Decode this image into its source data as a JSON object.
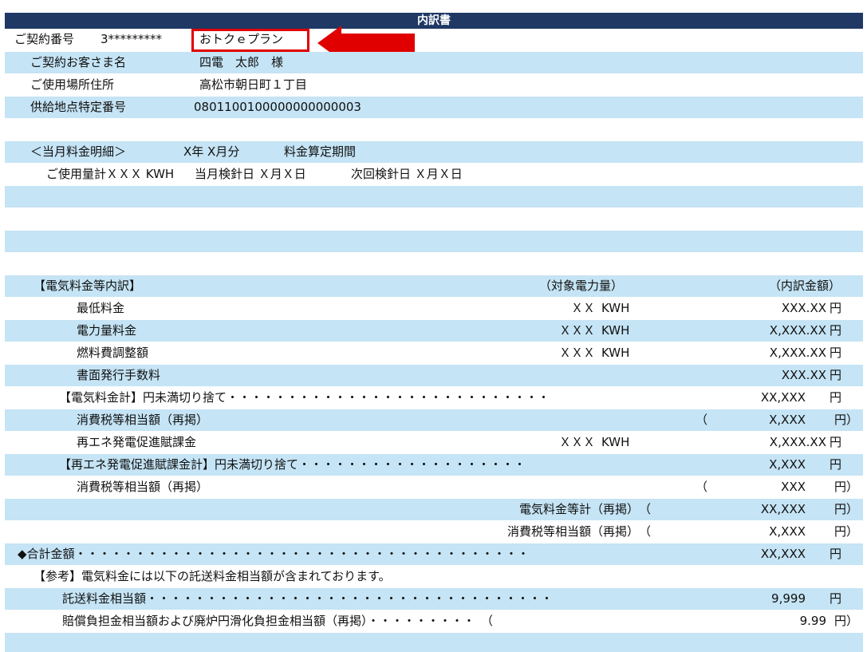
{
  "title": "内訳書",
  "contract": {
    "number_label": "ご契約番号",
    "number_value": "3*********",
    "plan": "おトクｅプラン",
    "customer_label": "ご契約お客さま名",
    "customer_value": "四電　太郎　様",
    "address_label": "ご使用場所住所",
    "address_value": "高松市朝日町１丁目",
    "supply_label": "供給地点特定番号",
    "supply_value": "0801100100000000000003"
  },
  "period": {
    "heading": "＜当月料金明細＞",
    "month": "X年 X月分",
    "calc_label": "料金算定期間",
    "usage": "ご使用量計ＸＸＸ KWH",
    "this_meter": "当月検針日 Ｘ月Ｘ日",
    "next_meter": "次回検針日 Ｘ月Ｘ日"
  },
  "breakdown": {
    "heading": "【電気料金等内訳】",
    "col_power": "（対象電力量）",
    "col_amount": "（内訳金額）",
    "rows": [
      {
        "label": "最低料金",
        "qty": "ＸＸ",
        "unit": "KWH",
        "amount": "XXX.XX",
        "yen": "円"
      },
      {
        "label": "電力量料金",
        "qty": "ＸＸＸ",
        "unit": "KWH",
        "amount": "X,XXX.XX",
        "yen": "円"
      },
      {
        "label": "燃料費調整額",
        "qty": "ＸＸＸ",
        "unit": "KWH",
        "amount": "X,XXX.XX",
        "yen": "円"
      },
      {
        "label": "書面発行手数料",
        "qty": "",
        "unit": "",
        "amount": "XXX.XX",
        "yen": "円"
      }
    ],
    "elec_total_label": "【電気料金計】円未満切り捨て・・・・・・・・・・・・・・・・・・・・・・・・・・・",
    "elec_total_amount": "XX,XXX",
    "elec_total_yen": "円",
    "tax1_label": "消費税等相当額（再掲）",
    "tax1_open": "（",
    "tax1_amount": "X,XXX",
    "tax1_yen": "円）",
    "renew_label": "再エネ発電促進賦課金",
    "renew_qty": "ＸＸＸ",
    "renew_unit": "KWH",
    "renew_amount": "X,XXX.XX",
    "renew_yen": "円",
    "renew_total_label": "【再エネ発電促進賦課金計】円未満切り捨て・・・・・・・・・・・・・・・・・・・",
    "renew_total_amount": "X,XXX",
    "renew_total_yen": "円",
    "tax2_label": "消費税等相当額（再掲）",
    "tax2_open": "（",
    "tax2_amount": "XXX",
    "tax2_yen": "円）",
    "elec_sum_label": "電気料金等計（再掲）　（",
    "elec_sum_amount": "XX,XXX",
    "elec_sum_yen": "円）",
    "tax_sum_label": "消費税等相当額（再掲）　（",
    "tax_sum_amount": "X,XXX",
    "tax_sum_yen": "円）",
    "grand_label": "◆合計金額・・・・・・・・・・・・・・・・・・・・・・・・・・・・・・・・・・・・・・",
    "grand_amount": "XX,XXX",
    "grand_yen": "円"
  },
  "reference": {
    "note": "【参考】電気料金には以下の託送料金相当額が含まれております。",
    "wheel_label": "託送料金相当額・・・・・・・・・・・・・・・・・・・・・・・・・・・・・・・・・・",
    "wheel_amount": "9,999",
    "wheel_yen": "円",
    "comp_label": "賠償負担金相当額および廃炉円滑化負担金相当額（再掲）・・・・・・・・・　（",
    "comp_amount": "9.99",
    "comp_yen": "円）"
  },
  "colors": {
    "header": "#1f3864",
    "band": "#c5e4f5",
    "highlight": "#e00000"
  }
}
